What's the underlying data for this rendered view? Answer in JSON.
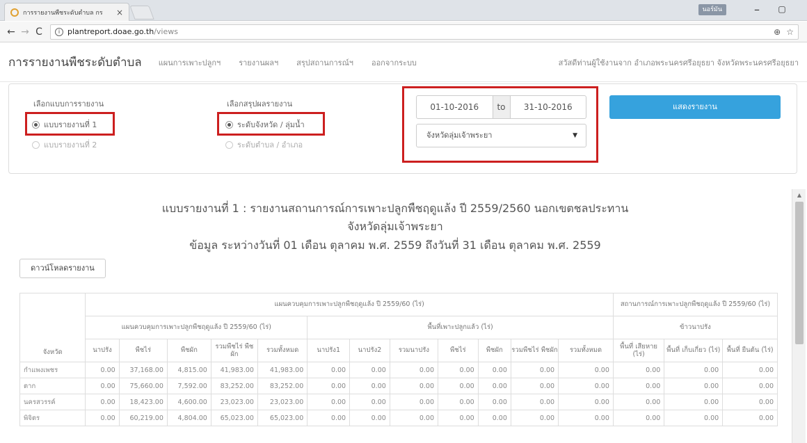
{
  "browser": {
    "tab_title": "การรายงานพืชระดับตำบล กร",
    "tab_close": "×",
    "user_badge": "นอร์มัน",
    "min_glyph": "–",
    "max_glyph": "▢",
    "url_host": "plantreport.doae.go.th",
    "url_path": "/views",
    "back": "←",
    "forward": "→",
    "reload": "C",
    "info": "i",
    "zoom_icon": "⊕",
    "star_icon": "☆"
  },
  "navbar": {
    "brand": "การรายงานพืชระดับตำบล",
    "items": [
      "แผนการเพาะปลูกฯ",
      "รายงานผลฯ",
      "สรุปสถานการณ์ฯ",
      "ออกจากระบบ"
    ],
    "greeting": "สวัสดีท่านผู้ใช้งานจาก อำเภอพระนครศรีอยุธยา จังหวัดพระนครศรีอยุธยา"
  },
  "filters": {
    "report_type_title": "เลือกแบบการรายงาน",
    "report_type_options": [
      "แบบรายงานที่ 1",
      "แบบรายงานที่ 2"
    ],
    "summary_title": "เลือกสรุปผลรายงาน",
    "summary_options": [
      "ระดับจังหวัด / ลุ่มน้ำ",
      "ระดับตำบล / อำเภอ"
    ],
    "date_from": "01-10-2016",
    "date_to_label": "to",
    "date_to": "31-10-2016",
    "region_select": "จังหวัดลุ่มเจ้าพระยา",
    "select_caret": "▼",
    "show_button": "แสดงรายงาน"
  },
  "report": {
    "title_line1": "แบบรายงานที่ 1 : รายงานสถานการณ์การเพาะปลูกพืชฤดูแล้ง ปี 2559/2560 นอกเขตชลประทาน",
    "title_line2": "จังหวัดลุ่มเจ้าพระยา",
    "title_line3": "ข้อมูล ระหว่างวันที่ 01 เดือน ตุลาคม พ.ศ. 2559 ถึงวันที่ 31 เดือน ตุลาคม พ.ศ. 2559",
    "download_button": "ดาวน์โหลดรายงาน",
    "table": {
      "province_header": "จังหวัด",
      "group_plan": "แผนควบคุมการเพาะปลูกพืชฤดูแล้ง ปี 2559/60 (ไร่)",
      "group_situation": "สถานการณ์การเพาะปลูกพืชฤดูแล้ง ปี 2559/60 (ไร่)",
      "sub_plan": "แผนควบคุมการเพาะปลูกพืชฤดูแล้ง ปี 2559/60 (ไร่)",
      "sub_planted": "พื้นที่เพาะปลูกแล้ว (ไร่)",
      "sub_rice": "ข้าวนาปรัง",
      "columns": [
        "นาปรัง",
        "พืชไร่",
        "พืชผัก",
        "รวมพืชไร่ พืชผัก",
        "รวมทั้งหมด",
        "นาปรัง1",
        "นาปรัง2",
        "รวมนาปรัง",
        "พืชไร่",
        "พืชผัก",
        "รวมพืชไร่ พืชผัก",
        "รวมทั้งหมด",
        "พื้นที่ เสียหาย (ไร่)",
        "พื้นที่ เก็บเกี่ยว (ไร่)",
        "พื้นที่ ยืนต้น (ไร่)"
      ],
      "rows": [
        {
          "province": "กำแพงเพชร",
          "values": [
            "0.00",
            "37,168.00",
            "4,815.00",
            "41,983.00",
            "41,983.00",
            "0.00",
            "0.00",
            "0.00",
            "0.00",
            "0.00",
            "0.00",
            "0.00",
            "0.00",
            "0.00",
            "0.00"
          ]
        },
        {
          "province": "ตาก",
          "values": [
            "0.00",
            "75,660.00",
            "7,592.00",
            "83,252.00",
            "83,252.00",
            "0.00",
            "0.00",
            "0.00",
            "0.00",
            "0.00",
            "0.00",
            "0.00",
            "0.00",
            "0.00",
            "0.00"
          ]
        },
        {
          "province": "นครสวรรค์",
          "values": [
            "0.00",
            "18,423.00",
            "4,600.00",
            "23,023.00",
            "23,023.00",
            "0.00",
            "0.00",
            "0.00",
            "0.00",
            "0.00",
            "0.00",
            "0.00",
            "0.00",
            "0.00",
            "0.00"
          ]
        },
        {
          "province": "พิจิตร",
          "values": [
            "0.00",
            "60,219.00",
            "4,804.00",
            "65,023.00",
            "65,023.00",
            "0.00",
            "0.00",
            "0.00",
            "0.00",
            "0.00",
            "0.00",
            "0.00",
            "0.00",
            "0.00",
            "0.00"
          ]
        }
      ]
    }
  },
  "colors": {
    "highlight": "#cc1f1f",
    "primary_button": "#36a2dd"
  }
}
